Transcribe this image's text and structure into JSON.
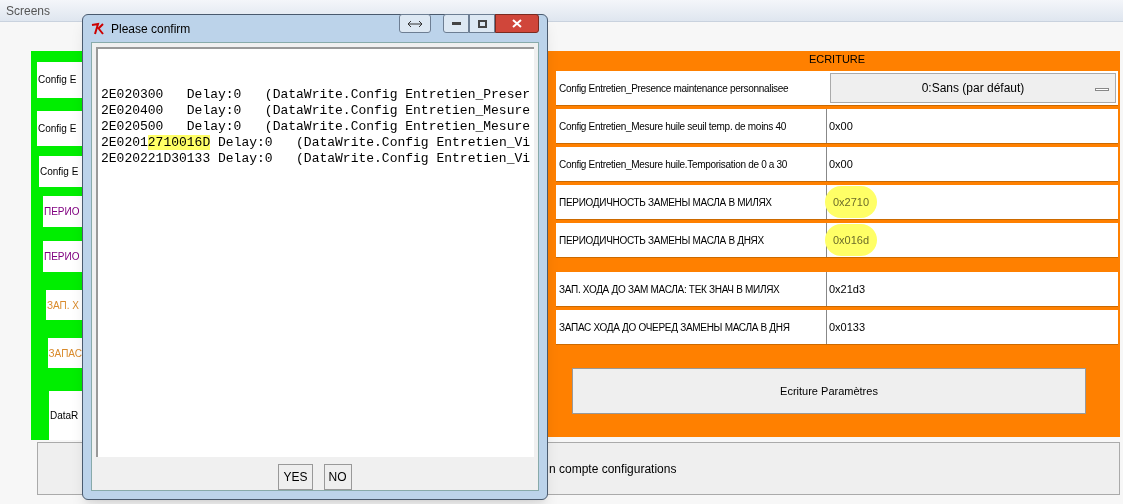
{
  "app_bar": {
    "title": "Screens"
  },
  "left_cards": [
    {
      "label": "Config E",
      "color": "#000000"
    },
    {
      "label": "Config E",
      "color": "#000000"
    },
    {
      "label": "Config E",
      "color": "#000000"
    },
    {
      "label": "ПЕРИО",
      "color": "#800080"
    },
    {
      "label": "ПЕРИО",
      "color": "#800080"
    },
    {
      "label": "ЗАП. Х",
      "color": "#d98a2b"
    },
    {
      "label": "ЗАПАС",
      "color": "#d98a2b"
    },
    {
      "label": "DataR",
      "color": "#000000"
    }
  ],
  "write_panel": {
    "title": "ECRITURE",
    "rows": [
      {
        "kind": "dropdown",
        "label": "Config Entretien_Presence maintenance personnalisee",
        "value": "0:Sans (par défaut)"
      },
      {
        "kind": "field",
        "label": "Config Entretien_Mesure huile seuil temp. de moins 40",
        "value": "0x00",
        "highlighted": false
      },
      {
        "kind": "field",
        "label": "Config Entretien_Mesure huile.Temporisation de 0 a 30",
        "value": "0x00",
        "highlighted": false
      },
      {
        "kind": "field",
        "label": "ПЕРИОДИЧНОСТЬ ЗАМЕНЫ МАСЛА В МИЛЯХ",
        "value": "0x2710",
        "highlighted": true
      },
      {
        "kind": "field",
        "label": "ПЕРИОДИЧНОСТЬ ЗАМЕНЫ МАСЛА В ДНЯХ",
        "value": "0x016d",
        "highlighted": true
      },
      {
        "kind": "gap"
      },
      {
        "kind": "field",
        "label": "ЗАП. ХОДА ДО ЗАМ МАСЛА: ТЕК ЗНАЧ В МИЛЯХ",
        "value": "0x21d3",
        "highlighted": false
      },
      {
        "kind": "field",
        "label": "ЗАПАС ХОДА ДО ОЧЕРЕД ЗАМЕНЫ МАСЛА В ДНЯ",
        "value": "0x0133",
        "highlighted": false
      }
    ],
    "button": "Ecriture Paramètres"
  },
  "bottom_bar": {
    "text": "n compte configurations"
  },
  "dialog": {
    "title": "Please confirm",
    "lines": [
      [
        {
          "text": "2E020300   Delay:0   (DataWrite.Config Entretien_Preser",
          "highlighted": false
        }
      ],
      [
        {
          "text": "2E020400   Delay:0   (DataWrite.Config Entretien_Mesure",
          "highlighted": false
        }
      ],
      [
        {
          "text": "2E020500   Delay:0   (DataWrite.Config Entretien_Mesure",
          "highlighted": false
        }
      ],
      [
        {
          "text": "2E0201",
          "highlighted": false
        },
        {
          "text": "2710016D",
          "highlighted": true
        },
        {
          "text": " Delay:0   (DataWrite.Config Entretien_Vi",
          "highlighted": false
        }
      ],
      [
        {
          "text": "2E020221D30133 Delay:0   (DataWrite.Config Entretien_Vi",
          "highlighted": false
        }
      ]
    ],
    "buttons": [
      "YES",
      "NO"
    ]
  }
}
